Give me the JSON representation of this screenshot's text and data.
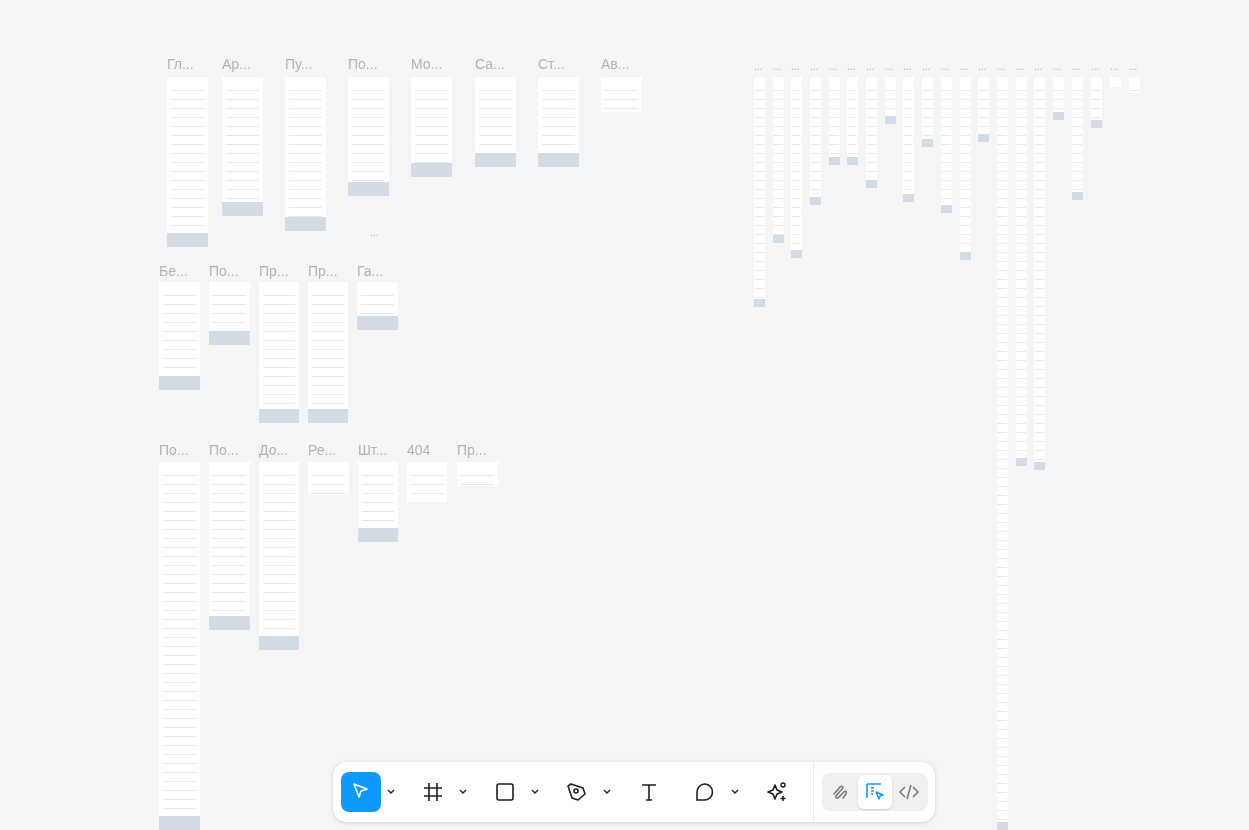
{
  "canvas": {
    "frames": [
      {
        "label": "Гл..."
      },
      {
        "label": "Ар..."
      },
      {
        "label": "Пу..."
      },
      {
        "label": "По..."
      },
      {
        "label": "Мо..."
      },
      {
        "label": "Са..."
      },
      {
        "label": "Ст..."
      },
      {
        "label": "Ав..."
      },
      {
        "label": "Бе..."
      },
      {
        "label": "По..."
      },
      {
        "label": "Пр..."
      },
      {
        "label": "Пр..."
      },
      {
        "label": "Га..."
      },
      {
        "label": "По..."
      },
      {
        "label": "По..."
      },
      {
        "label": "До..."
      },
      {
        "label": "Ре..."
      },
      {
        "label": "Шт..."
      },
      {
        "label": "404"
      },
      {
        "label": "Пр..."
      }
    ],
    "stray_label": "...",
    "narrow_frames": [
      {
        "label": "..."
      },
      {
        "label": "..."
      },
      {
        "label": "..."
      },
      {
        "label": "..."
      },
      {
        "label": "..."
      },
      {
        "label": "..."
      },
      {
        "label": "..."
      },
      {
        "label": "..."
      },
      {
        "label": "..."
      },
      {
        "label": "..."
      },
      {
        "label": "..."
      },
      {
        "label": "..."
      },
      {
        "label": "..."
      },
      {
        "label": "..."
      },
      {
        "label": "..."
      },
      {
        "label": "..."
      },
      {
        "label": "..."
      },
      {
        "label": "..."
      },
      {
        "label": "..."
      },
      {
        "label": "..."
      },
      {
        "label": "..."
      }
    ]
  },
  "toolbar": {
    "tools": [
      {
        "kind": "move",
        "selected": true,
        "dropdown": true
      },
      {
        "kind": "frame",
        "selected": false,
        "dropdown": true
      },
      {
        "kind": "rectangle",
        "selected": false,
        "dropdown": true
      },
      {
        "kind": "pen",
        "selected": false,
        "dropdown": true
      },
      {
        "kind": "text",
        "selected": false,
        "dropdown": false
      },
      {
        "kind": "comment",
        "selected": false,
        "dropdown": true
      },
      {
        "kind": "sparkle",
        "selected": false,
        "dropdown": false
      }
    ],
    "modes": [
      {
        "kind": "draw",
        "selected": false
      },
      {
        "kind": "design",
        "selected": true
      },
      {
        "kind": "dev",
        "selected": false
      }
    ]
  }
}
